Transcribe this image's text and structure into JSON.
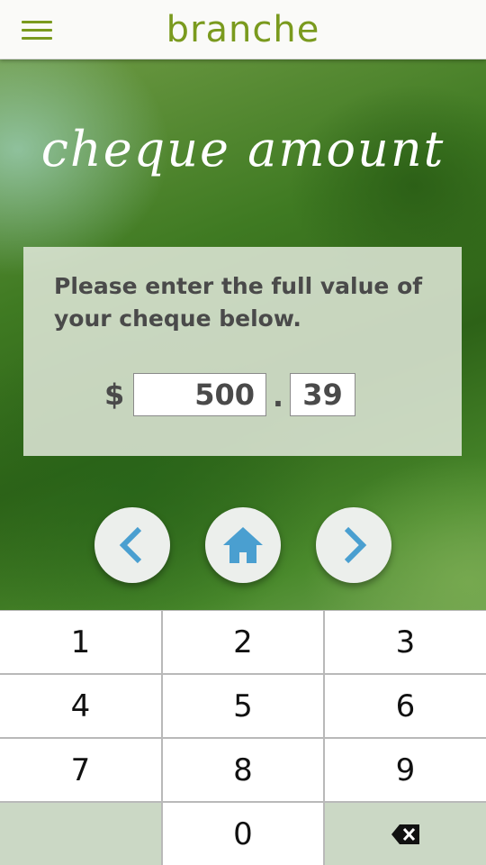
{
  "header": {
    "brand": "branche",
    "menu_icon": "hamburger-menu-icon"
  },
  "page": {
    "title": "cheque amount",
    "instructions": "Please enter the full value of your cheque below."
  },
  "amount": {
    "currency_symbol": "$",
    "dollars": "500",
    "decimal_separator": ".",
    "cents": "39"
  },
  "nav": {
    "back_icon": "chevron-left-icon",
    "home_icon": "home-icon",
    "next_icon": "chevron-right-icon",
    "icon_color": "#4a9fd0"
  },
  "keypad": {
    "keys": [
      "1",
      "2",
      "3",
      "4",
      "5",
      "6",
      "7",
      "8",
      "9",
      "",
      "0",
      ""
    ],
    "backspace_icon": "backspace-icon"
  },
  "colors": {
    "brand": "#7a9a1e",
    "key_shade": "#cbd8c5",
    "panel_text": "#4a4a4a"
  }
}
